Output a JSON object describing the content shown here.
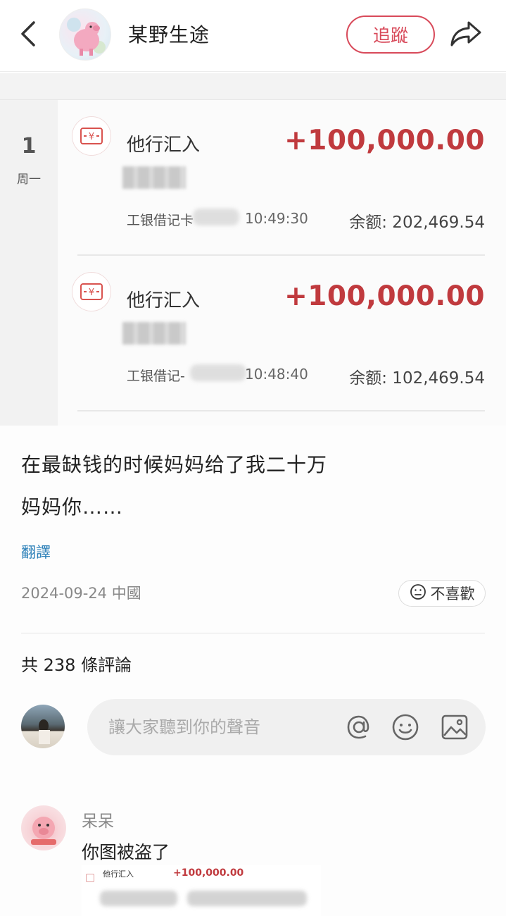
{
  "header": {
    "username": "某野生途",
    "follow_label": "追蹤"
  },
  "screenshot": {
    "day_number": "1",
    "day_week": "周一",
    "transactions": [
      {
        "title": "他行汇入",
        "amount": "+100,000.00",
        "card": "工银借记卡",
        "time": "10:49:30",
        "balance": "余额: 202,469.54"
      },
      {
        "title": "他行汇入",
        "amount": "+100,000.00",
        "card": "工银借记-",
        "time": "10:48:40",
        "balance": "余额: 102,469.54"
      }
    ],
    "accent_color": "#c03a3e"
  },
  "post": {
    "line1": "在最缺钱的时候妈妈给了我二十万",
    "line2": "妈妈你……",
    "translate_label": "翻譯",
    "meta": "2024-09-24 中國",
    "dislike_label": "不喜歡"
  },
  "comments": {
    "count_label": "共 238 條評論",
    "input_placeholder": "讓大家聽到你的聲音",
    "reply": {
      "name": "呆呆",
      "text": "你图被盗了",
      "image_title": "他行汇入",
      "image_amount": "+100,000.00"
    }
  }
}
